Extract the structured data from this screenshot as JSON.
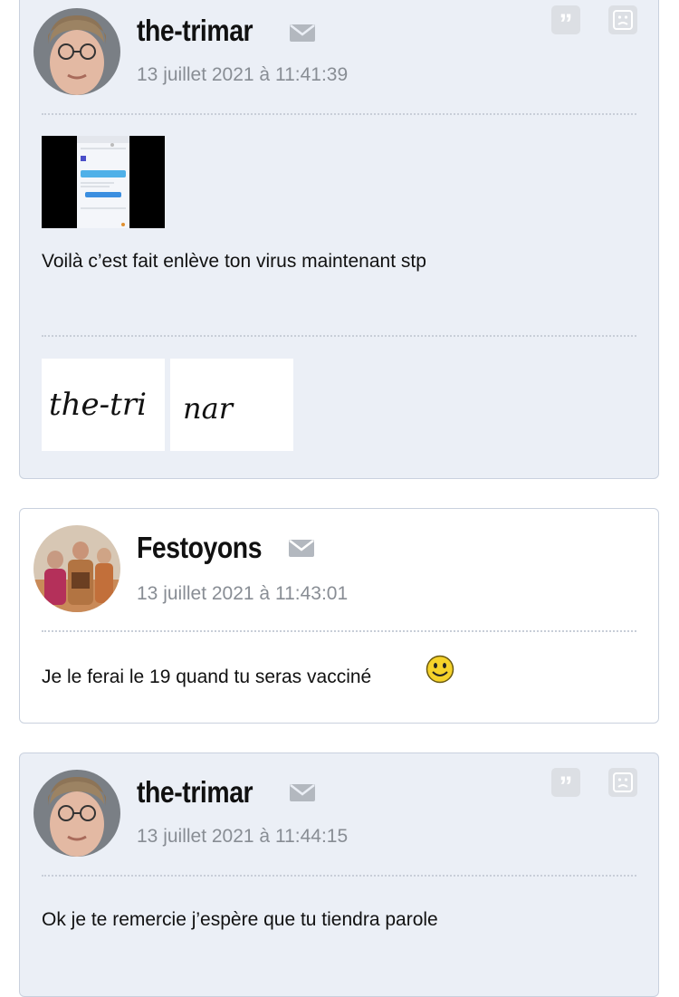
{
  "posts": [
    {
      "username": "the-trimar",
      "date": "13 juillet 2021 à 11:41:39",
      "message": "Voilà c’est fait enlève ton virus maintenant stp",
      "signature": [
        "the-tri",
        "nar"
      ]
    },
    {
      "username": "Festoyons",
      "date": "13 juillet 2021 à 11:43:01",
      "message": "Je le ferai le 19 quand tu seras vacciné"
    },
    {
      "username": "the-trimar",
      "date": "13 juillet 2021 à 11:44:15",
      "message": "Ok je te remercie j’espère que tu tiendra parole"
    }
  ],
  "icons": {
    "mail": "mail-icon",
    "quote": "quote-icon",
    "report": "sad-face-icon",
    "smiley": "smiley-icon"
  }
}
